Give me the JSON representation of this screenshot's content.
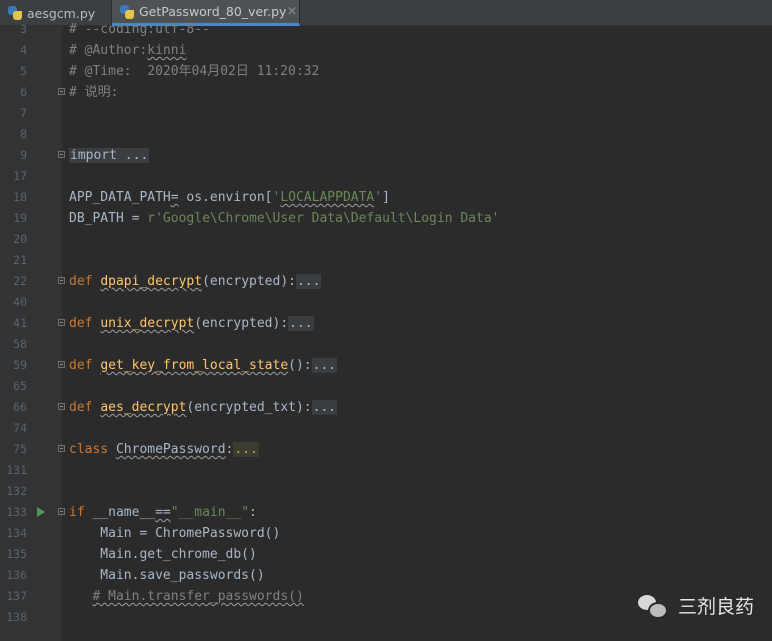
{
  "tabs": [
    {
      "label": "aesgcm.py",
      "active": false
    },
    {
      "label": "GetPassword_80_ver.py",
      "active": true
    }
  ],
  "editor": {
    "lines": [
      {
        "n": "3",
        "text": "# --coding:utf-8--"
      },
      {
        "n": "4",
        "text": "# @Author:kinni"
      },
      {
        "n": "5",
        "text": "# @Time:  2020年04月02日 11:20:32"
      },
      {
        "n": "6",
        "text": "# 说明:"
      },
      {
        "n": "7",
        "text": ""
      },
      {
        "n": "8",
        "text": ""
      },
      {
        "n": "9",
        "text": "import ..."
      },
      {
        "n": "17",
        "text": ""
      },
      {
        "n": "18",
        "text": "APP_DATA_PATH= os.environ['LOCALAPPDATA']"
      },
      {
        "n": "19",
        "text": "DB_PATH = r'Google\\Chrome\\User Data\\Default\\Login Data'"
      },
      {
        "n": "20",
        "text": ""
      },
      {
        "n": "21",
        "text": ""
      },
      {
        "n": "22",
        "text": "def dpapi_decrypt(encrypted):..."
      },
      {
        "n": "40",
        "text": ""
      },
      {
        "n": "41",
        "text": "def unix_decrypt(encrypted):..."
      },
      {
        "n": "58",
        "text": ""
      },
      {
        "n": "59",
        "text": "def get_key_from_local_state():..."
      },
      {
        "n": "65",
        "text": ""
      },
      {
        "n": "66",
        "text": "def aes_decrypt(encrypted_txt):..."
      },
      {
        "n": "74",
        "text": ""
      },
      {
        "n": "75",
        "text": "class ChromePassword:..."
      },
      {
        "n": "131",
        "text": ""
      },
      {
        "n": "132",
        "text": ""
      },
      {
        "n": "133",
        "text": "if __name__==\"__main__\":"
      },
      {
        "n": "134",
        "text": "    Main = ChromePassword()"
      },
      {
        "n": "135",
        "text": "    Main.get_chrome_db()"
      },
      {
        "n": "136",
        "text": "    Main.save_passwords()"
      },
      {
        "n": "137",
        "text": "   # Main.transfer_passwords()"
      },
      {
        "n": "138",
        "text": ""
      }
    ]
  },
  "watermark": {
    "text": "三剂良药",
    "icon": "wechat-icon"
  },
  "colors": {
    "background": "#2b2b2b",
    "gutter": "#313335",
    "keyword": "#cc7832",
    "function": "#ffc66d",
    "string": "#6a8759",
    "comment": "#808080",
    "text": "#a9b7c6",
    "run_marker": "#499c54"
  }
}
